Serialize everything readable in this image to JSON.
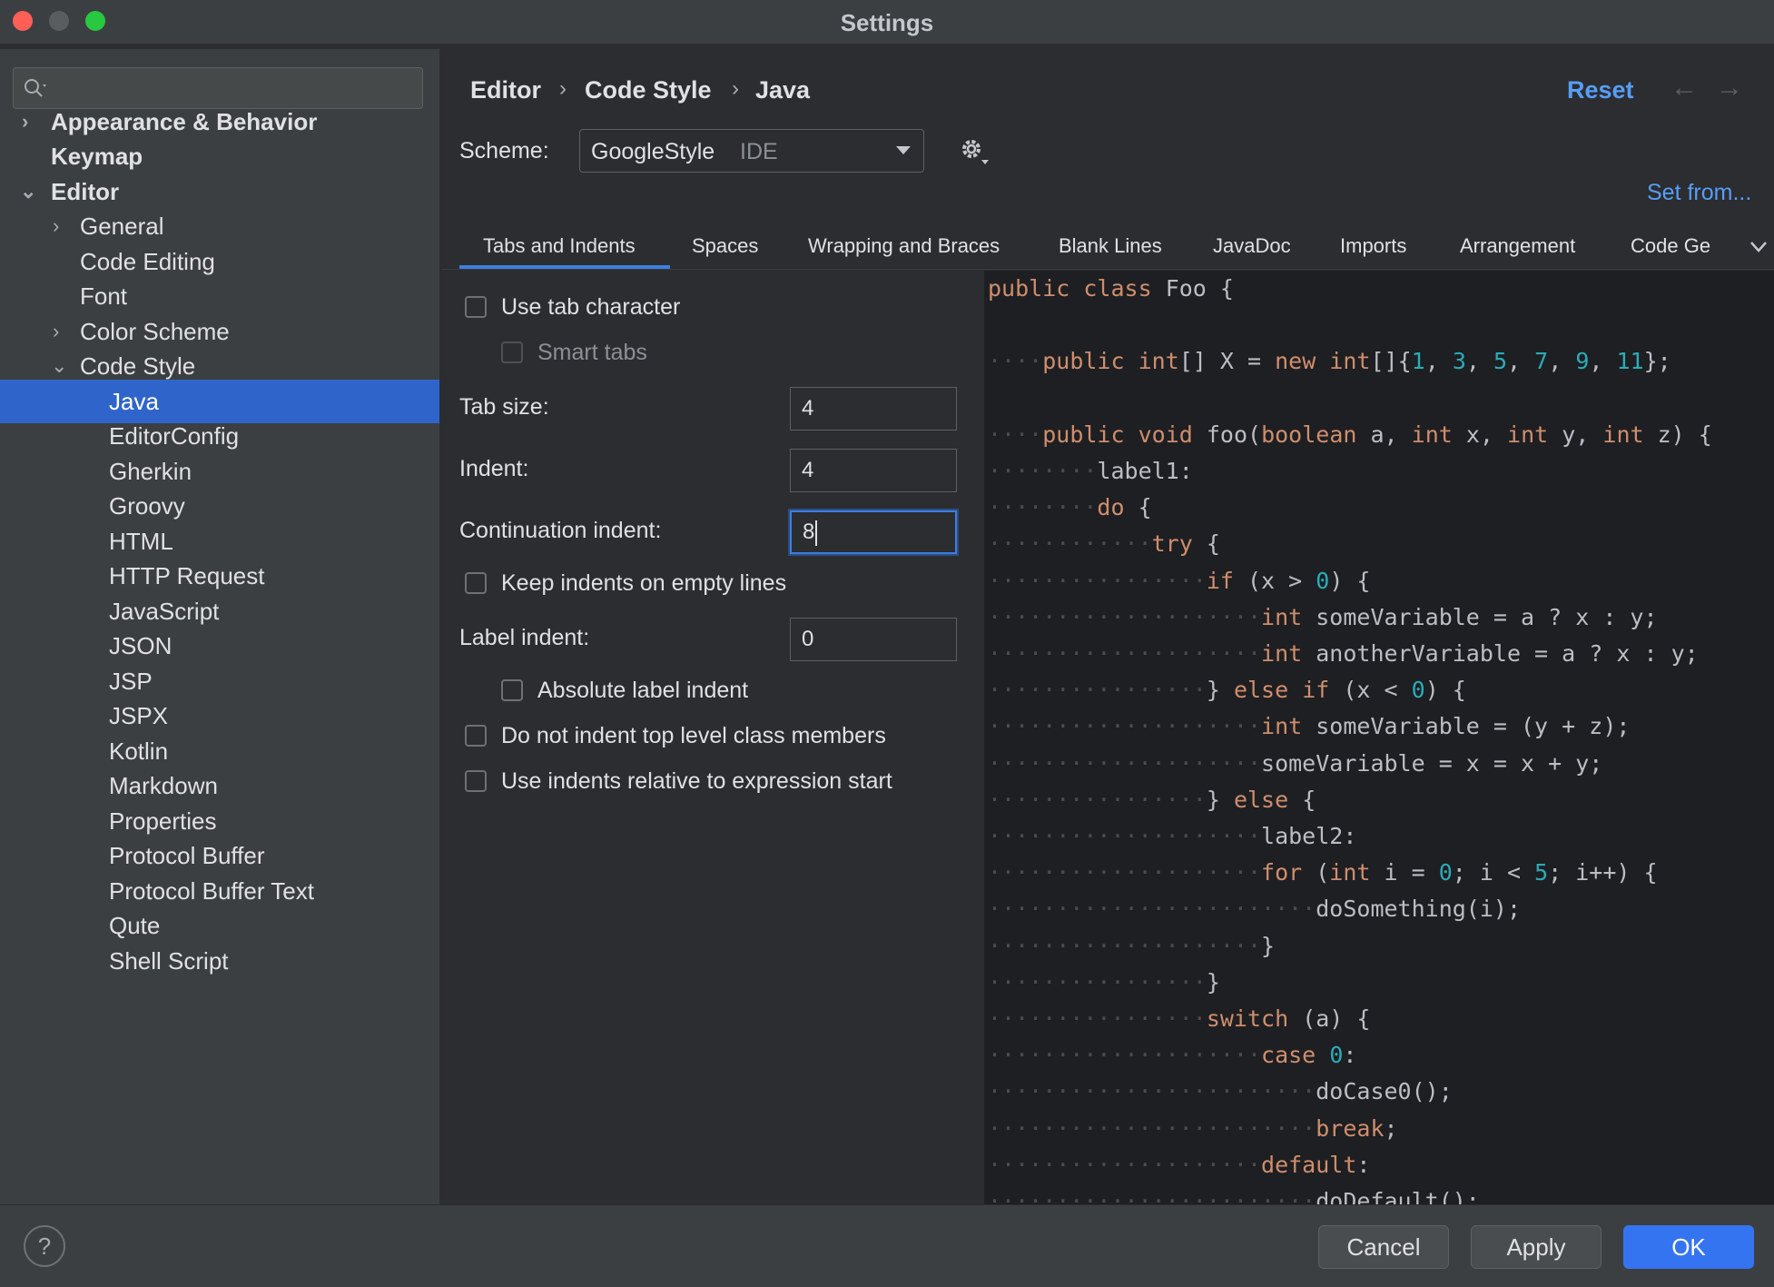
{
  "window": {
    "title": "Settings"
  },
  "sidebar": {
    "search_placeholder": "",
    "items": [
      {
        "label": "Appearance & Behavior"
      },
      {
        "label": "Keymap"
      },
      {
        "label": "Editor"
      },
      {
        "label": "General"
      },
      {
        "label": "Code Editing"
      },
      {
        "label": "Font"
      },
      {
        "label": "Color Scheme"
      },
      {
        "label": "Code Style"
      },
      {
        "label": "Java"
      },
      {
        "label": "EditorConfig"
      },
      {
        "label": "Gherkin"
      },
      {
        "label": "Groovy"
      },
      {
        "label": "HTML"
      },
      {
        "label": "HTTP Request"
      },
      {
        "label": "JavaScript"
      },
      {
        "label": "JSON"
      },
      {
        "label": "JSP"
      },
      {
        "label": "JSPX"
      },
      {
        "label": "Kotlin"
      },
      {
        "label": "Markdown"
      },
      {
        "label": "Properties"
      },
      {
        "label": "Protocol Buffer"
      },
      {
        "label": "Protocol Buffer Text"
      },
      {
        "label": "Qute"
      },
      {
        "label": "Shell Script"
      }
    ]
  },
  "header": {
    "breadcrumb": [
      "Editor",
      "Code Style",
      "Java"
    ],
    "reset_label": "Reset"
  },
  "scheme": {
    "label": "Scheme:",
    "value": "GoogleStyle",
    "tag": "IDE",
    "set_from_label": "Set from..."
  },
  "tabs": [
    {
      "label": "Tabs and Indents"
    },
    {
      "label": "Spaces"
    },
    {
      "label": "Wrapping and Braces"
    },
    {
      "label": "Blank Lines"
    },
    {
      "label": "JavaDoc"
    },
    {
      "label": "Imports"
    },
    {
      "label": "Arrangement"
    },
    {
      "label": "Code Ge"
    }
  ],
  "options": {
    "use_tab_character": "Use tab character",
    "smart_tabs": "Smart tabs",
    "tab_size_label": "Tab size:",
    "tab_size_value": "4",
    "indent_label": "Indent:",
    "indent_value": "4",
    "continuation_indent_label": "Continuation indent:",
    "continuation_indent_value": "8",
    "keep_indents_empty": "Keep indents on empty lines",
    "label_indent_label": "Label indent:",
    "label_indent_value": "0",
    "absolute_label_indent": "Absolute label indent",
    "no_indent_top_level": "Do not indent top level class members",
    "relative_to_expression": "Use indents relative to expression start"
  },
  "code_preview": [
    "public class Foo {",
    "",
    "    public int[] X = new int[]{1, 3, 5, 7, 9, 11};",
    "",
    "    public void foo(boolean a, int x, int y, int z) {",
    "        label1:",
    "        do {",
    "            try {",
    "                if (x > 0) {",
    "                    int someVariable = a ? x : y;",
    "                    int anotherVariable = a ? x : y;",
    "                } else if (x < 0) {",
    "                    int someVariable = (y + z);",
    "                    someVariable = x = x + y;",
    "                } else {",
    "                    label2:",
    "                    for (int i = 0; i < 5; i++) {",
    "                        doSomething(i);",
    "                    }",
    "                }",
    "                switch (a) {",
    "                    case 0:",
    "                        doCase0();",
    "                        break;",
    "                    default:",
    "                        doDefault();"
  ],
  "footer": {
    "help_label": "?",
    "cancel_label": "Cancel",
    "apply_label": "Apply",
    "ok_label": "OK"
  },
  "colors": {
    "accent": "#3574f0",
    "selection": "#2f65ca",
    "link": "#589df6",
    "keyword": "#cf8e6d",
    "number": "#2aacb8"
  }
}
